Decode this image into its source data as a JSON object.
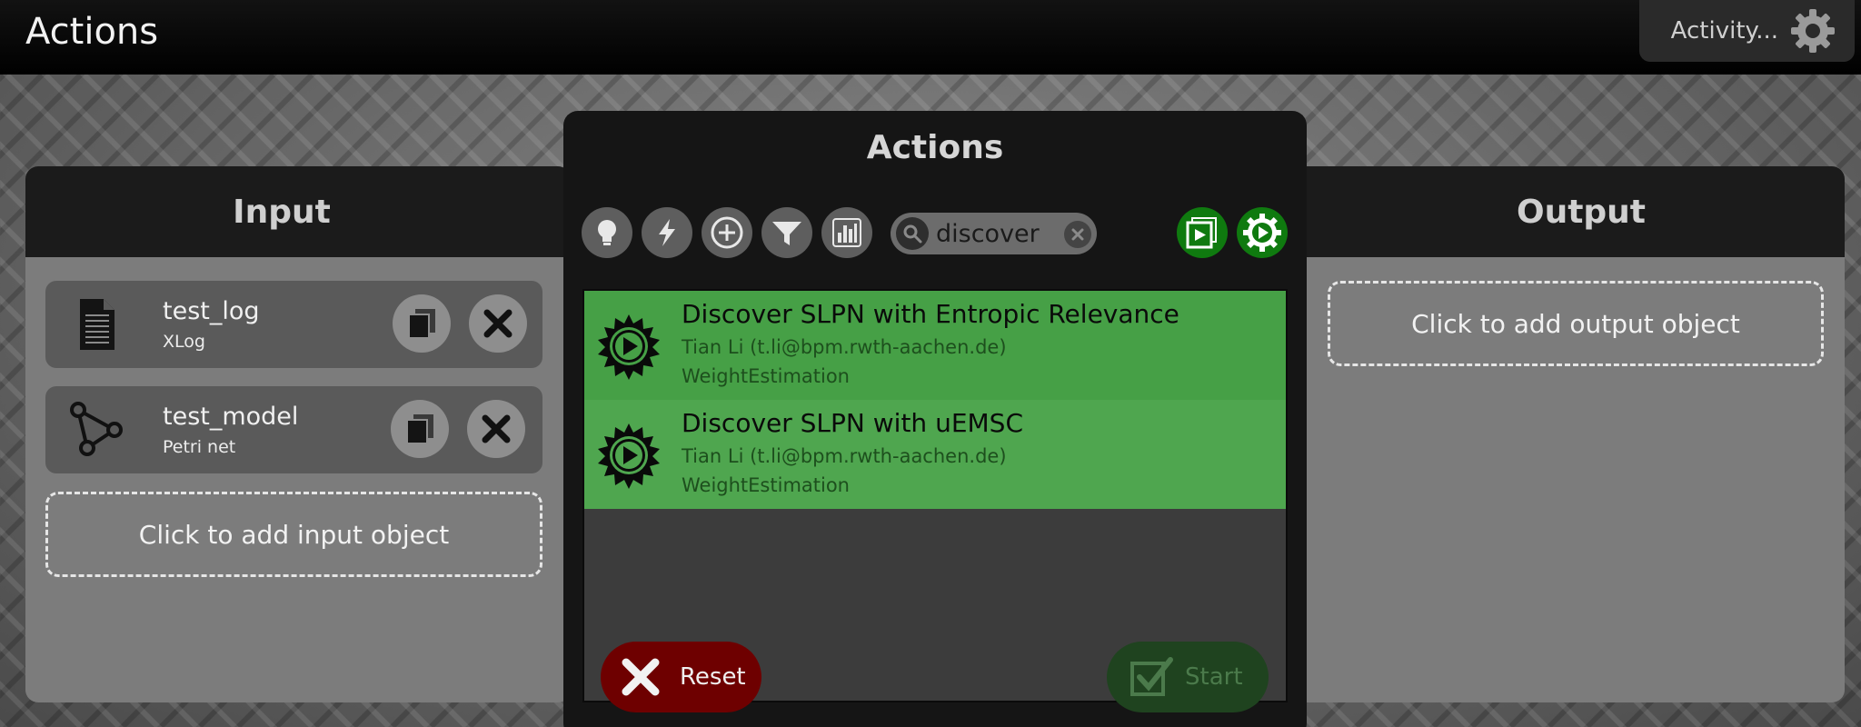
{
  "header": {
    "title": "Actions",
    "activity_label": "Activity...",
    "activity_icon": "gear-icon"
  },
  "input_panel": {
    "title": "Input",
    "objects": [
      {
        "name": "test_log",
        "type": "XLog",
        "icon": "document-icon"
      },
      {
        "name": "test_model",
        "type": "Petri net",
        "icon": "petri-net-icon"
      }
    ],
    "add_label": "Click to add input object"
  },
  "output_panel": {
    "title": "Output",
    "add_label": "Click to add output object"
  },
  "dialog": {
    "title": "Actions",
    "toolbar_icons": [
      "lightbulb-icon",
      "lightning-icon",
      "plus-circle-icon",
      "filter-icon",
      "bar-chart-icon"
    ],
    "search": {
      "value": "discover",
      "placeholder": ""
    },
    "results": [
      {
        "title": "Discover SLPN with Entropic Relevance",
        "author": "Tian Li (t.li@bpm.rwth-aachen.de)",
        "package": "WeightEstimation"
      },
      {
        "title": "Discover SLPN with uEMSC",
        "author": "Tian Li (t.li@bpm.rwth-aachen.de)",
        "package": "WeightEstimation"
      }
    ],
    "reset_label": "Reset",
    "start_label": "Start"
  },
  "colors": {
    "result_green": "#46a046",
    "reset_red": "#6e0000",
    "start_green_disabled": "#1f431f",
    "toolbar_green": "#0f7a0f"
  }
}
